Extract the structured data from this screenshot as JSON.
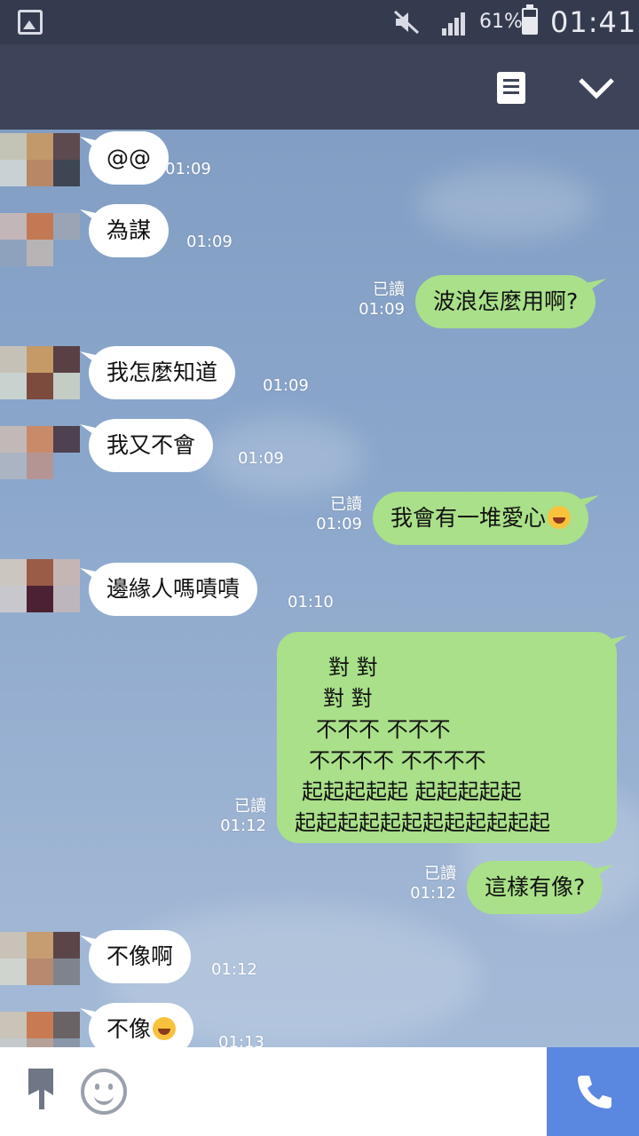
{
  "status_bar": {
    "battery_percent": "61%",
    "time": "01:41",
    "icons": [
      "gallery-icon",
      "mute-icon",
      "signal-icon",
      "battery-icon"
    ]
  },
  "header": {
    "icons": [
      "notes-icon",
      "chevron-down-icon"
    ]
  },
  "messages": [
    {
      "dir": "in",
      "text": "@@",
      "time": "01:09"
    },
    {
      "dir": "in",
      "text": "為謀",
      "time": "01:09"
    },
    {
      "dir": "out",
      "text": "波浪怎麼用啊?",
      "time": "01:09",
      "read": "已讀"
    },
    {
      "dir": "in",
      "text": "我怎麼知道",
      "time": "01:09"
    },
    {
      "dir": "in",
      "text": "我又不會",
      "time": "01:09"
    },
    {
      "dir": "out",
      "text": "我會有一堆愛心",
      "emoji": "laughing-crying-emoji",
      "time": "01:09",
      "read": "已讀"
    },
    {
      "dir": "in",
      "text": "邊緣人嗎嘖嘖",
      "time": "01:10"
    },
    {
      "dir": "out",
      "lines": [
        "對                    對",
        "對                  對",
        "不不不           不不不",
        "不不不不      不不不不",
        "起起起起起  起起起起起",
        "起起起起起起起起起起起起"
      ],
      "time": "01:12",
      "read": "已讀"
    },
    {
      "dir": "out",
      "text": "這樣有像?",
      "time": "01:12",
      "read": "已讀"
    },
    {
      "dir": "in",
      "text": "不像啊",
      "time": "01:12"
    },
    {
      "dir": "in",
      "text": "不像",
      "emoji": "crying-emoji",
      "time": "01:13"
    }
  ],
  "bottom_bar": {
    "icons": [
      "attach-icon",
      "emoji-icon",
      "call-icon"
    ],
    "call_color": "#5a87e0"
  },
  "colors": {
    "incoming_bubble": "#ffffff",
    "outgoing_bubble": "#a9e089",
    "header": "#3d4459"
  }
}
